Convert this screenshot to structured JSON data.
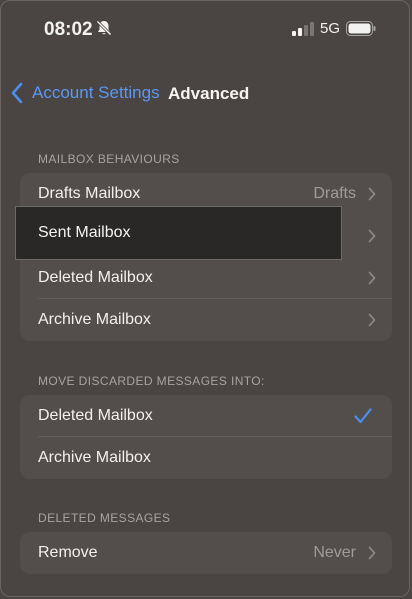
{
  "status_bar": {
    "time": "08:02",
    "network": "5G",
    "icons": [
      "bell-slash-icon",
      "signal-icon",
      "battery-icon"
    ]
  },
  "nav": {
    "back_label": "Account Settings",
    "title": "Advanced"
  },
  "sections": [
    {
      "header": "MAILBOX BEHAVIOURS",
      "rows": [
        {
          "label": "Drafts Mailbox",
          "value": "Drafts"
        },
        {
          "label": "Sent Mailbox",
          "value": ""
        },
        {
          "label": "Deleted Mailbox",
          "value": ""
        },
        {
          "label": "Archive Mailbox",
          "value": ""
        }
      ]
    },
    {
      "header": "MOVE DISCARDED MESSAGES INTO:",
      "rows": [
        {
          "label": "Deleted Mailbox",
          "selected": true
        },
        {
          "label": "Archive Mailbox",
          "selected": false
        }
      ]
    },
    {
      "header": "DELETED MESSAGES",
      "rows": [
        {
          "label": "Remove",
          "value": "Never"
        }
      ]
    }
  ],
  "colors": {
    "background": "#4a4543",
    "group": "#534e4c",
    "accent": "#4a8ff0",
    "highlight": "#2a2827"
  }
}
